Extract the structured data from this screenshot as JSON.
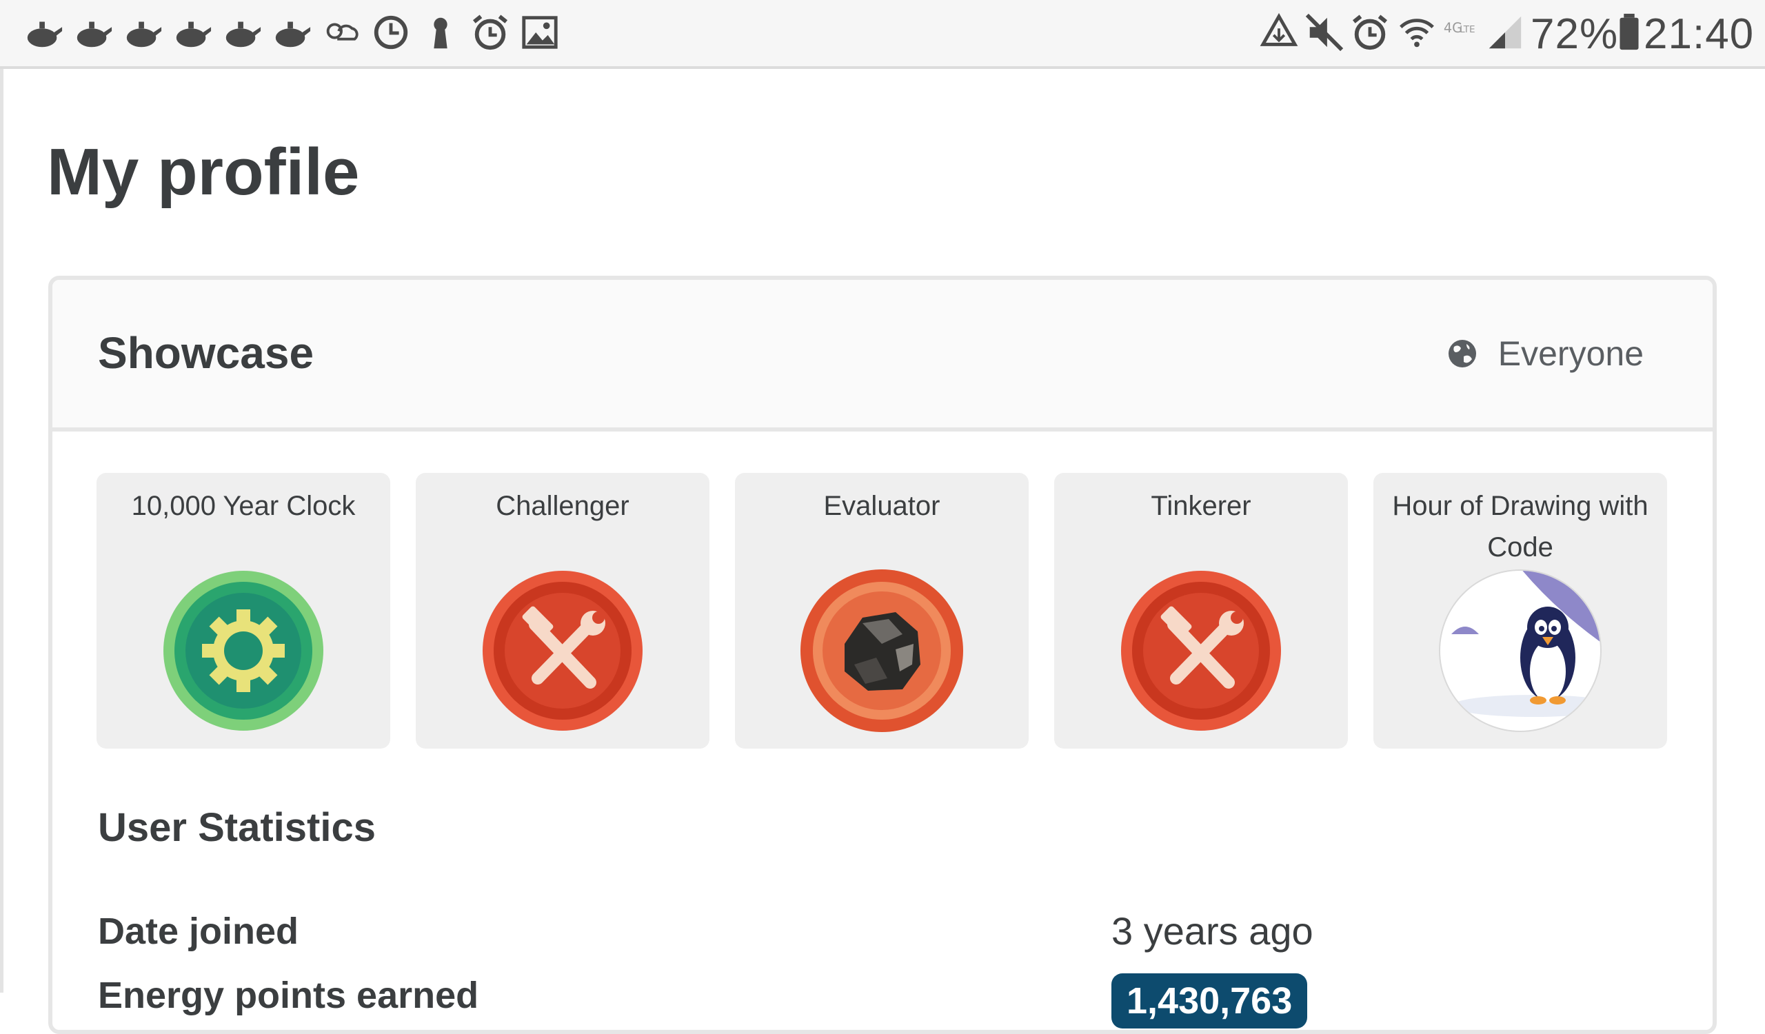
{
  "status_bar": {
    "left_icons": [
      "teapot-icon",
      "teapot-icon",
      "teapot-icon",
      "teapot-icon",
      "teapot-icon",
      "teapot-icon",
      "weather-icon",
      "clock-icon",
      "keyhole-icon",
      "alarm-icon",
      "image-icon"
    ],
    "right_icons": [
      "recycle-icon",
      "mute-icon",
      "alarm-icon",
      "wifi-icon",
      "4g-lte-icon",
      "signal-icon",
      "battery-icon"
    ],
    "battery_percent": "72%",
    "time": "21:40"
  },
  "page": {
    "title": "My profile"
  },
  "showcase": {
    "title": "Showcase",
    "visibility": "Everyone",
    "visibility_icon": "globe-icon",
    "badges": [
      {
        "name": "10,000 Year Clock",
        "icon": "gear-badge-icon",
        "color": "#1f9a6b"
      },
      {
        "name": "Challenger",
        "icon": "tools-badge-icon",
        "color": "#d8452c"
      },
      {
        "name": "Evaluator",
        "icon": "rock-badge-icon",
        "color": "#e0522f"
      },
      {
        "name": "Tinkerer",
        "icon": "tools-badge-icon",
        "color": "#d8452c"
      },
      {
        "name": "Hour of Drawing with Code",
        "icon": "penguin-badge-icon",
        "color": "#8e88c9"
      }
    ]
  },
  "stats": {
    "title": "User Statistics",
    "rows": [
      {
        "label": "Date joined",
        "value": "3 years ago"
      },
      {
        "label": "Energy points earned",
        "value": "1,430,763"
      }
    ]
  },
  "colors": {
    "accent_pill": "#0d4b6e",
    "text": "#3b3e40"
  }
}
